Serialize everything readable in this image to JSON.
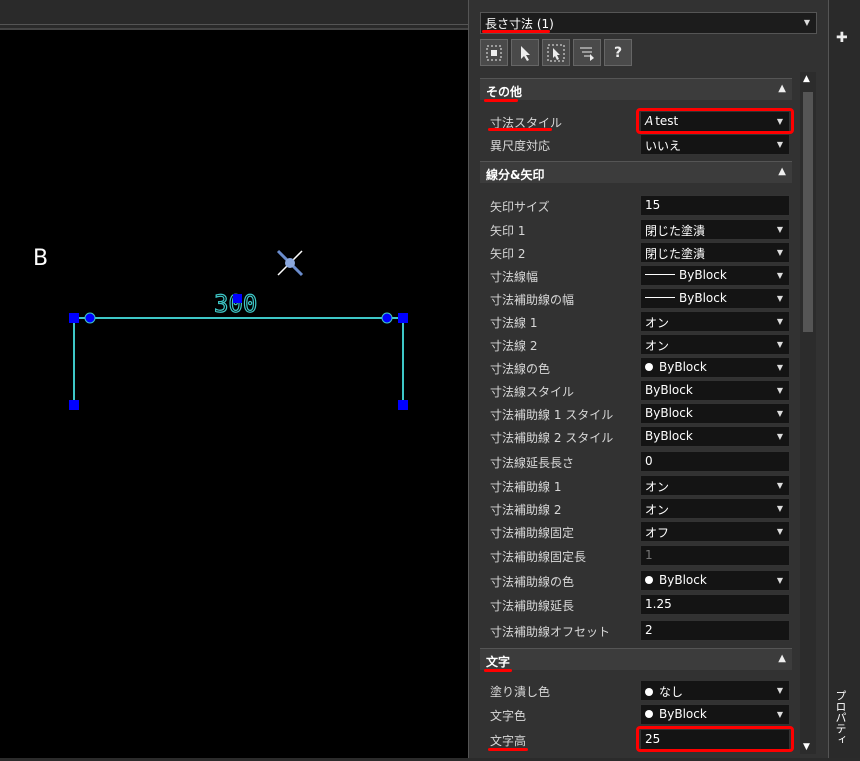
{
  "selection": {
    "label": "長さ寸法 (1)"
  },
  "toolbar": {
    "help_label": "?"
  },
  "canvas": {
    "letter": "B",
    "dimension_text": "300"
  },
  "sections": {
    "other": {
      "title": "その他"
    },
    "lines": {
      "title": "線分&矢印"
    },
    "text": {
      "title": "文字"
    }
  },
  "props": {
    "dim_style": {
      "label": "寸法スタイル",
      "value": "test"
    },
    "annotative": {
      "label": "異尺度対応",
      "value": "いいえ"
    },
    "arrow_size": {
      "label": "矢印サイズ",
      "value": "15"
    },
    "arrow1": {
      "label": "矢印 1",
      "value": "閉じた塗潰"
    },
    "arrow2": {
      "label": "矢印 2",
      "value": "閉じた塗潰"
    },
    "dim_line_weight": {
      "label": "寸法線幅",
      "value": "ByBlock"
    },
    "ext_line_weight": {
      "label": "寸法補助線の幅",
      "value": "ByBlock"
    },
    "dim_line1": {
      "label": "寸法線 1",
      "value": "オン"
    },
    "dim_line2": {
      "label": "寸法線 2",
      "value": "オン"
    },
    "dim_line_color": {
      "label": "寸法線の色",
      "value": "ByBlock"
    },
    "dim_line_style": {
      "label": "寸法線スタイル",
      "value": "ByBlock"
    },
    "ext_line1_style": {
      "label": "寸法補助線 1 スタイル",
      "value": "ByBlock"
    },
    "ext_line2_style": {
      "label": "寸法補助線 2 スタイル",
      "value": "ByBlock"
    },
    "dim_line_ext": {
      "label": "寸法線延長長さ",
      "value": "0"
    },
    "ext_line1": {
      "label": "寸法補助線 1",
      "value": "オン"
    },
    "ext_line2": {
      "label": "寸法補助線 2",
      "value": "オン"
    },
    "ext_fixed": {
      "label": "寸法補助線固定",
      "value": "オフ"
    },
    "ext_fixed_len": {
      "label": "寸法補助線固定長",
      "value": "1"
    },
    "ext_color": {
      "label": "寸法補助線の色",
      "value": "ByBlock"
    },
    "ext_extension": {
      "label": "寸法補助線延長",
      "value": "1.25"
    },
    "ext_offset": {
      "label": "寸法補助線オフセット",
      "value": "2"
    },
    "fill_color": {
      "label": "塗り潰し色",
      "value": "なし"
    },
    "text_color": {
      "label": "文字色",
      "value": "ByBlock"
    },
    "text_height": {
      "label": "文字高",
      "value": "25"
    }
  },
  "strip": {
    "tab_label": "プロパティ"
  },
  "colors": {
    "highlight": "#ff0000",
    "dimension": "#3ec7c7",
    "grip": "#0000ff"
  }
}
